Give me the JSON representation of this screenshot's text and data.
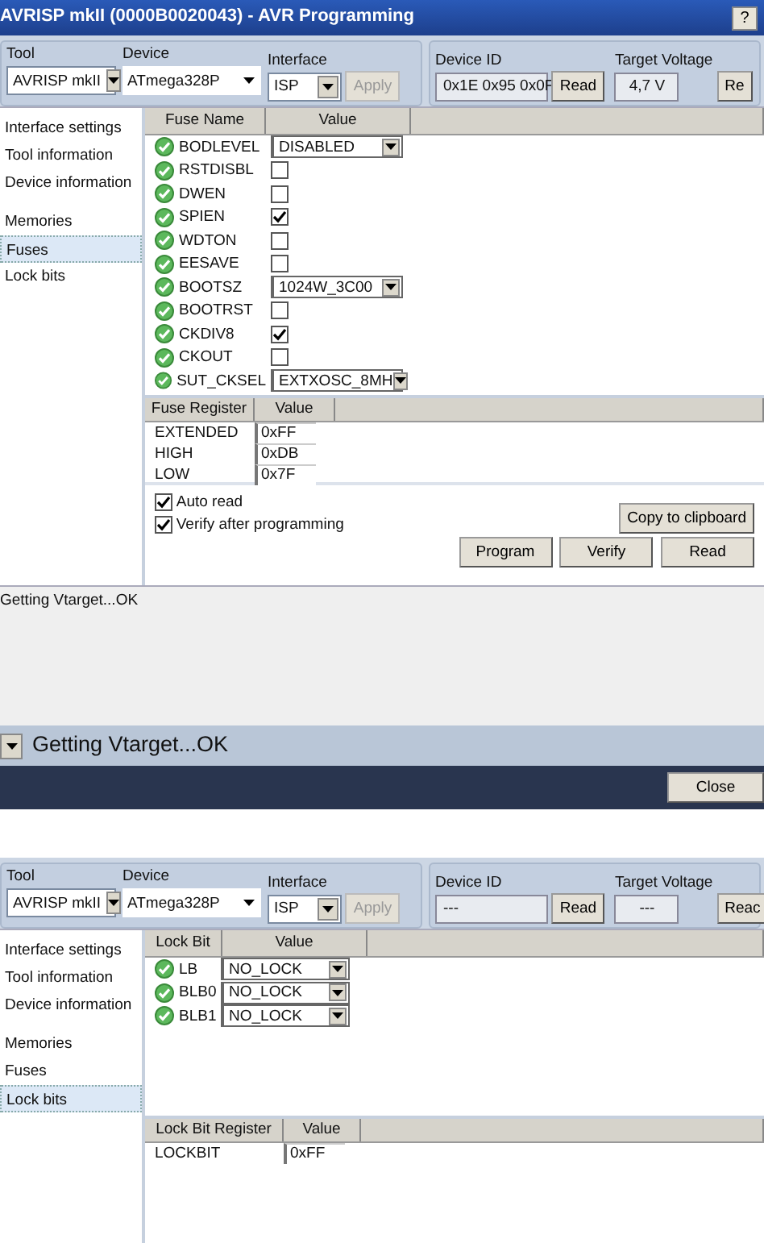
{
  "screens": [
    {
      "title": "AVRISP mkII (0000B0020043) - AVR Programming",
      "help": "?",
      "toolbar": {
        "tool_label": "Tool",
        "tool_value": "AVRISP mkII",
        "device_label": "Device",
        "device_value": "ATmega328P",
        "interface_label": "Interface",
        "interface_value": "ISP",
        "apply": "Apply",
        "apply_disabled": true,
        "device_id_label": "Device ID",
        "device_id_value": "0x1E 0x95 0x0F",
        "read": "Read",
        "voltage_label": "Target Voltage",
        "voltage_value": "4,7 V",
        "voltage_read": "Re"
      },
      "sidebar": [
        {
          "label": "Interface settings",
          "selected": false
        },
        {
          "label": "Tool information",
          "selected": false
        },
        {
          "label": "Device information",
          "selected": false
        },
        {
          "label": "Memories",
          "selected": false
        },
        {
          "label": "Fuses",
          "selected": true
        },
        {
          "label": "Lock bits",
          "selected": false
        }
      ],
      "table": {
        "columns": [
          "Fuse Name",
          "Value"
        ],
        "rows": [
          {
            "name": "BODLEVEL",
            "kind": "select",
            "value": "DISABLED"
          },
          {
            "name": "RSTDISBL",
            "kind": "check",
            "checked": false
          },
          {
            "name": "DWEN",
            "kind": "check",
            "checked": false
          },
          {
            "name": "SPIEN",
            "kind": "check",
            "checked": true
          },
          {
            "name": "WDTON",
            "kind": "check",
            "checked": false
          },
          {
            "name": "EESAVE",
            "kind": "check",
            "checked": false
          },
          {
            "name": "BOOTSZ",
            "kind": "select",
            "value": "1024W_3C00"
          },
          {
            "name": "BOOTRST",
            "kind": "check",
            "checked": false
          },
          {
            "name": "CKDIV8",
            "kind": "check",
            "checked": true
          },
          {
            "name": "CKOUT",
            "kind": "check",
            "checked": false
          },
          {
            "name": "SUT_CKSEL",
            "kind": "select",
            "value": "EXTXOSC_8MH"
          }
        ]
      },
      "register": {
        "columns": [
          "Fuse Register",
          "Value"
        ],
        "rows": [
          {
            "name": "EXTENDED",
            "value": "0xFF"
          },
          {
            "name": "HIGH",
            "value": "0xDB"
          },
          {
            "name": "LOW",
            "value": "0x7F"
          }
        ]
      },
      "options": [
        {
          "label": "Auto read",
          "checked": true
        },
        {
          "label": "Verify after programming",
          "checked": true
        }
      ],
      "copy_button": "Copy to clipboard",
      "buttons": [
        "Program",
        "Verify",
        "Read"
      ],
      "log": "Getting Vtarget...OK",
      "status": "Getting Vtarget...OK",
      "close": "Close"
    },
    {
      "toolbar": {
        "tool_label": "Tool",
        "tool_value": "AVRISP mkII",
        "device_label": "Device",
        "device_value": "ATmega328P",
        "interface_label": "Interface",
        "interface_value": "ISP",
        "apply": "Apply",
        "apply_disabled": true,
        "device_id_label": "Device ID",
        "device_id_value": "---",
        "read": "Read",
        "voltage_label": "Target Voltage",
        "voltage_value": "---",
        "voltage_read": "Reac"
      },
      "sidebar": [
        {
          "label": "Interface settings",
          "selected": false
        },
        {
          "label": "Tool information",
          "selected": false
        },
        {
          "label": "Device information",
          "selected": false
        },
        {
          "label": "Memories",
          "selected": false
        },
        {
          "label": "Fuses",
          "selected": false
        },
        {
          "label": "Lock bits",
          "selected": true
        }
      ],
      "table": {
        "columns": [
          "Lock Bit",
          "Value"
        ],
        "rows": [
          {
            "name": "LB",
            "kind": "select",
            "value": "NO_LOCK"
          },
          {
            "name": "BLB0",
            "kind": "select",
            "value": "NO_LOCK"
          },
          {
            "name": "BLB1",
            "kind": "select",
            "value": "NO_LOCK"
          }
        ]
      },
      "register": {
        "columns": [
          "Lock Bit Register",
          "Value"
        ],
        "rows": [
          {
            "name": "LOCKBIT",
            "value": "0xFF"
          }
        ]
      }
    }
  ]
}
